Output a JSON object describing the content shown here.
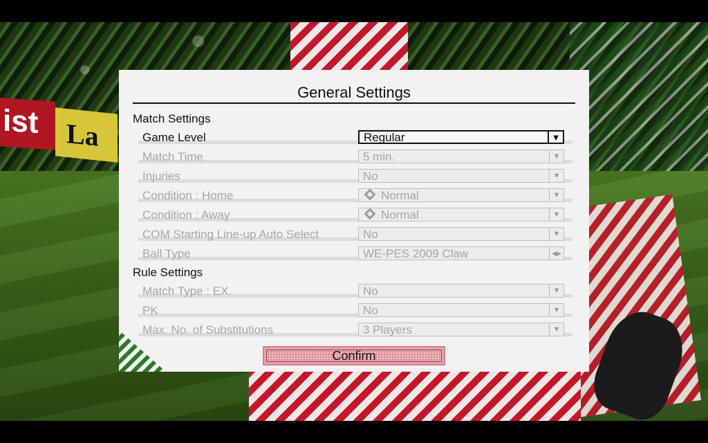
{
  "background": {
    "board_left_text": "ist",
    "board_right_text": "La"
  },
  "panel": {
    "title": "General Settings",
    "match_section": "Match Settings",
    "rule_section": "Rule Settings",
    "rows": [
      {
        "label": "Game Level",
        "value": "Regular",
        "control": "dropdown"
      },
      {
        "label": "Match Time",
        "value": "5 min.",
        "control": "dropdown"
      },
      {
        "label": "Injuries",
        "value": "No",
        "control": "dropdown"
      },
      {
        "label": "Condition : Home",
        "value": "Normal",
        "control": "dropdown",
        "icon": "condition-normal-icon"
      },
      {
        "label": "Condition : Away",
        "value": "Normal",
        "control": "dropdown",
        "icon": "condition-normal-icon"
      },
      {
        "label": "COM Starting Line-up Auto Select",
        "value": "No",
        "control": "dropdown"
      },
      {
        "label": "Ball Type",
        "value": "WE-PES 2009 Claw",
        "control": "left-right"
      },
      {
        "label": "Match Type : EX.",
        "value": "No",
        "control": "dropdown"
      },
      {
        "label": "PK",
        "value": "No",
        "control": "dropdown"
      },
      {
        "label": "Max. No. of Substitutions",
        "value": "3 Players",
        "control": "dropdown"
      }
    ],
    "arrows": {
      "dropdown": "▼",
      "left_right": "◀▶"
    },
    "confirm_label": "Confirm"
  },
  "colors": {
    "panel_bg": "#f2f2f2",
    "active_text": "#111111",
    "disabled_text": "#a6a6a6",
    "confirm_bg": "#efb6bb",
    "confirm_border": "#d87d85"
  }
}
